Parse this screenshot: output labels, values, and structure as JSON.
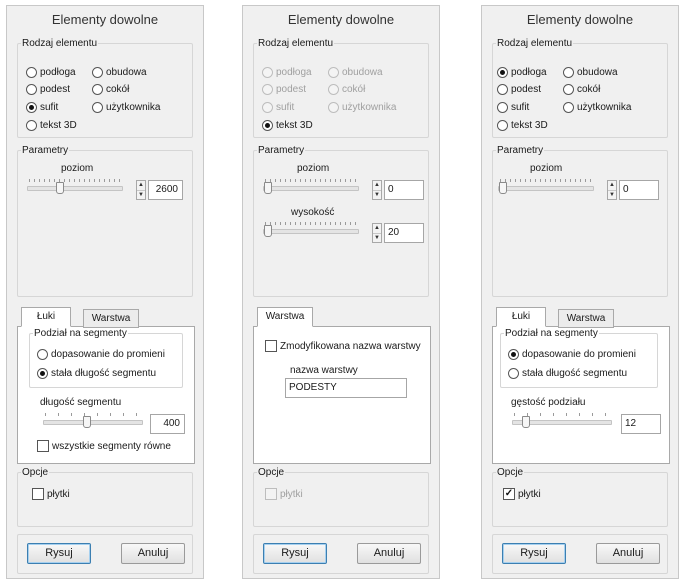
{
  "panels": [
    {
      "title": "Elementy dowolne",
      "type_group": "Rodzaj elementu",
      "types": [
        "podłoga",
        "obudowa",
        "podest",
        "cokół",
        "sufit",
        "użytkownika",
        "tekst 3D"
      ],
      "selected_type": "sufit",
      "params_group": "Parametry",
      "level_label": "poziom",
      "level_value": "2600",
      "tabs": [
        "Łuki",
        "Warstwa"
      ],
      "active_tab": "Łuki",
      "segments_group": "Podział na segmenty",
      "segment_options": [
        "dopasowanie do promieni",
        "stała długość segmentu"
      ],
      "selected_segment_option": "stała długość segmentu",
      "segment_length_label": "długość segmentu",
      "segment_length_value": "400",
      "equal_segments_label": "wszystkie segmenty równe",
      "equal_segments_checked": false,
      "options_group": "Opcje",
      "tiles_label": "płytki",
      "tiles_checked": false,
      "draw_button": "Rysuj",
      "cancel_button": "Anuluj"
    },
    {
      "title": "Elementy dowolne",
      "type_group": "Rodzaj elementu",
      "types": [
        "podłoga",
        "obudowa",
        "podest",
        "cokół",
        "sufit",
        "użytkownika",
        "tekst 3D"
      ],
      "selected_type": "tekst 3D",
      "types_disabled": true,
      "params_group": "Parametry",
      "level_label": "poziom",
      "level_value": "0",
      "height_label": "wysokość",
      "height_value": "20",
      "tabs": [
        "Warstwa"
      ],
      "active_tab": "Warstwa",
      "modified_layer_label": "Zmodyfikowana nazwa warstwy",
      "modified_layer_checked": false,
      "layer_name_label": "nazwa warstwy",
      "layer_name_value": "PODESTY",
      "options_group": "Opcje",
      "tiles_label": "płytki",
      "tiles_checked": false,
      "tiles_disabled": true,
      "draw_button": "Rysuj",
      "cancel_button": "Anuluj"
    },
    {
      "title": "Elementy dowolne",
      "type_group": "Rodzaj elementu",
      "types": [
        "podłoga",
        "obudowa",
        "podest",
        "cokół",
        "sufit",
        "użytkownika",
        "tekst 3D"
      ],
      "selected_type": "podłoga",
      "params_group": "Parametry",
      "level_label": "poziom",
      "level_value": "0",
      "tabs": [
        "Łuki",
        "Warstwa"
      ],
      "active_tab": "Łuki",
      "segments_group": "Podział na segmenty",
      "segment_options": [
        "dopasowanie do promieni",
        "stała długość segmentu"
      ],
      "selected_segment_option": "dopasowanie do promieni",
      "density_label": "gęstość podziału",
      "density_value": "12",
      "options_group": "Opcje",
      "tiles_label": "płytki",
      "tiles_checked": true,
      "draw_button": "Rysuj",
      "cancel_button": "Anuluj"
    }
  ]
}
